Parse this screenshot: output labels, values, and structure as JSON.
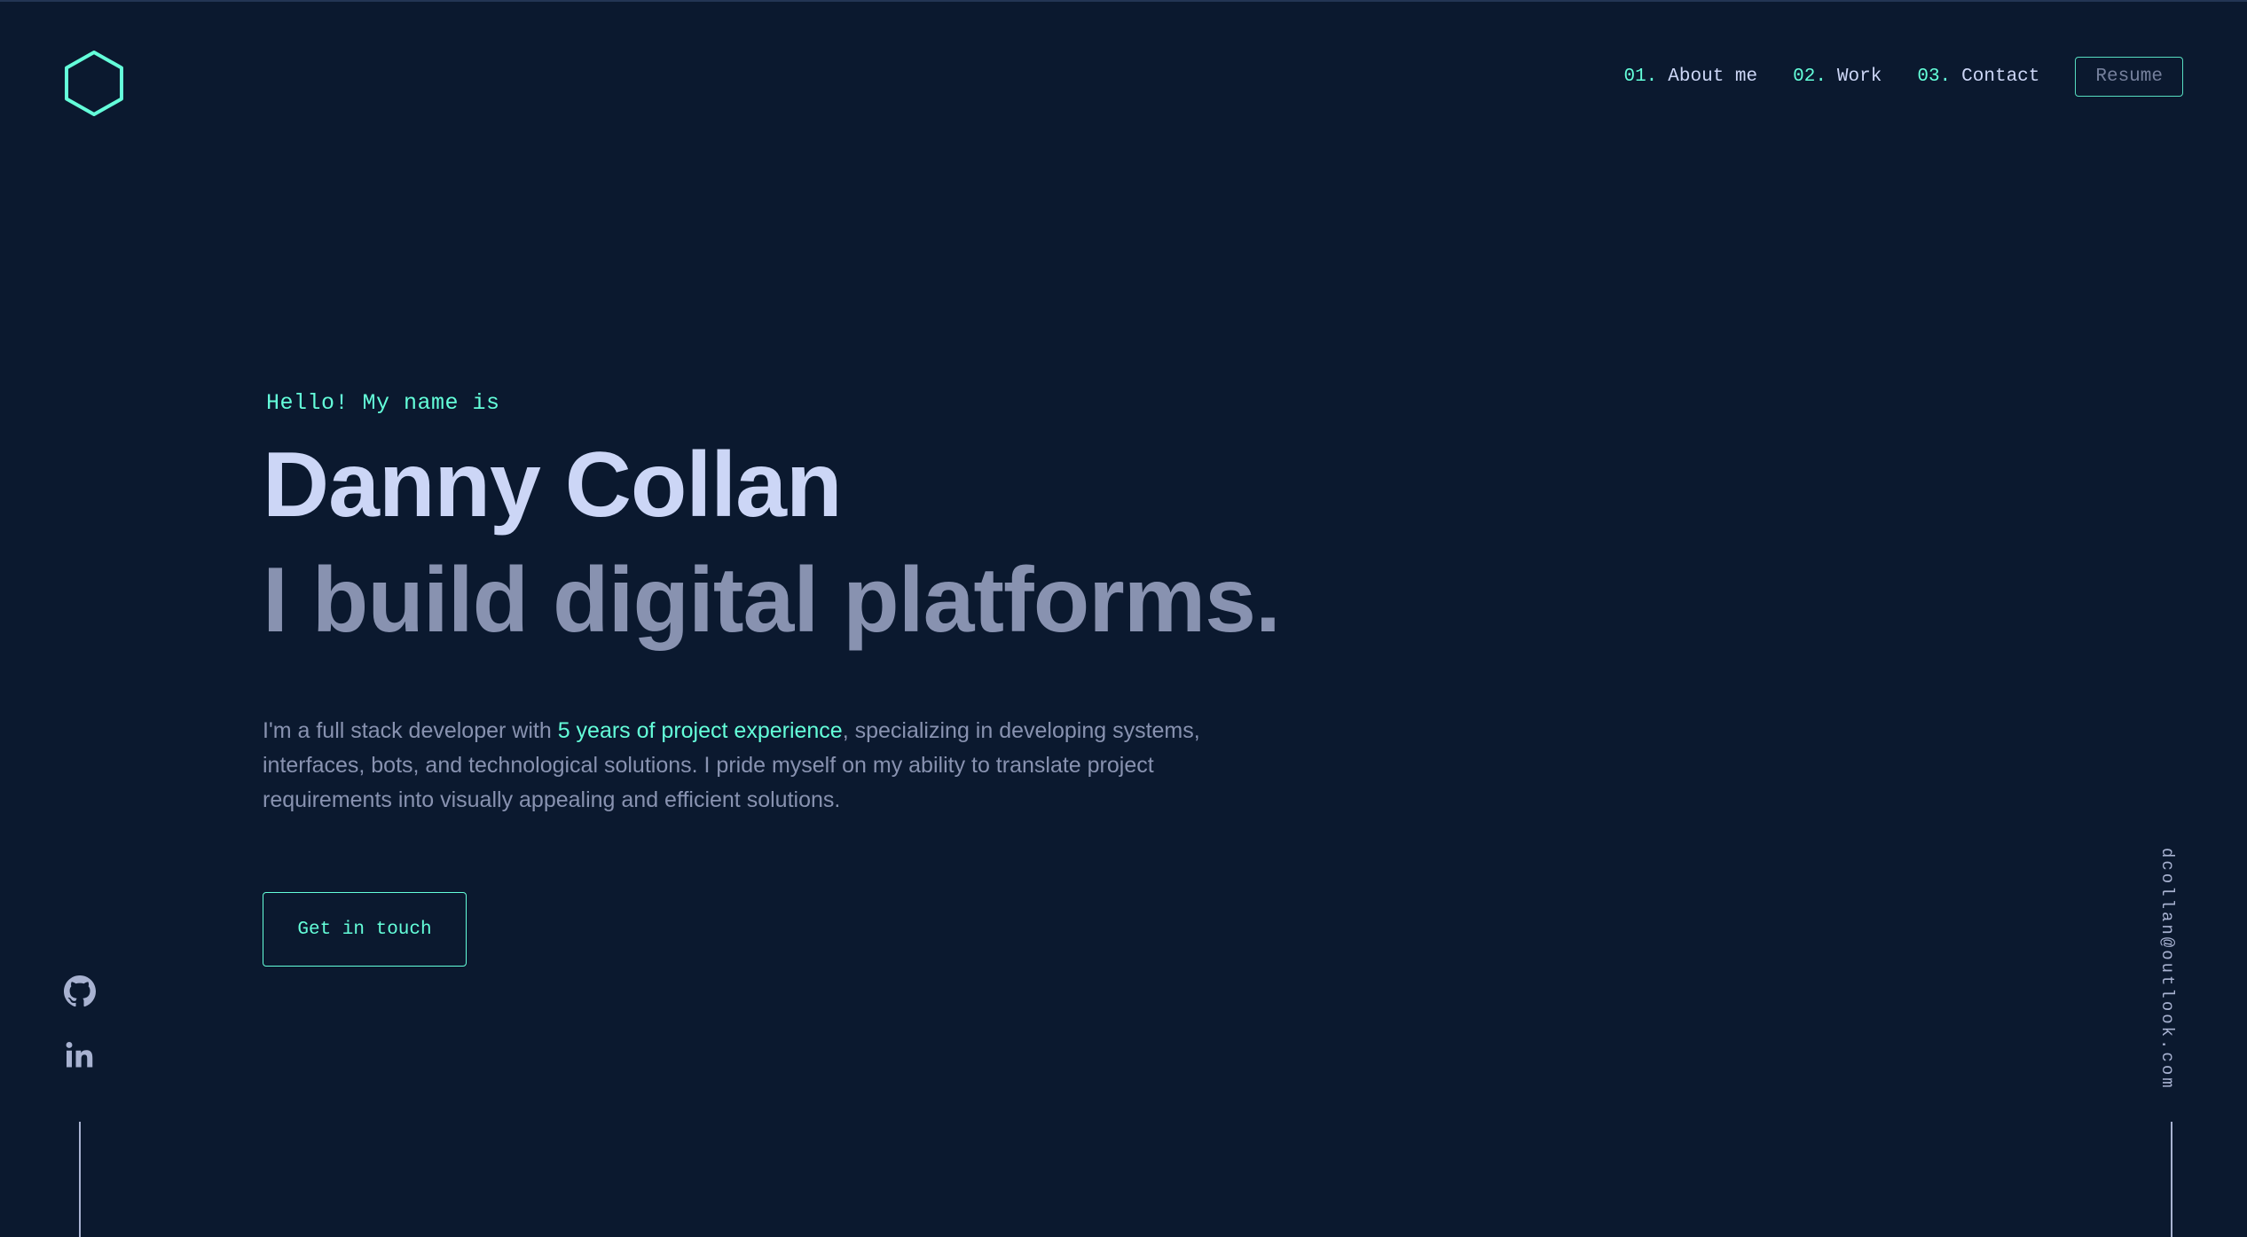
{
  "nav": {
    "items": [
      {
        "num": "01.",
        "label": "About me"
      },
      {
        "num": "02.",
        "label": "Work"
      },
      {
        "num": "03.",
        "label": "Contact"
      }
    ],
    "resume_label": "Resume"
  },
  "hero": {
    "greeting": "Hello! My name is",
    "name": "Danny Collan",
    "tagline": "I build digital platforms.",
    "bio_before": "I'm a full stack developer with ",
    "bio_highlight": "5 years of project experience",
    "bio_after": ", specializing in developing systems, interfaces, bots, and technological solutions. I pride myself on my ability to translate project requirements into visually appealing and efficient solutions.",
    "cta_label": "Get in touch"
  },
  "social": {
    "icons": [
      "github-icon",
      "linkedin-icon"
    ]
  },
  "email": "dcollan@outlook.com",
  "colors": {
    "background": "#0b192f",
    "accent": "#64ffda",
    "heading": "#ccd6f6",
    "body_text": "#8892b0"
  }
}
